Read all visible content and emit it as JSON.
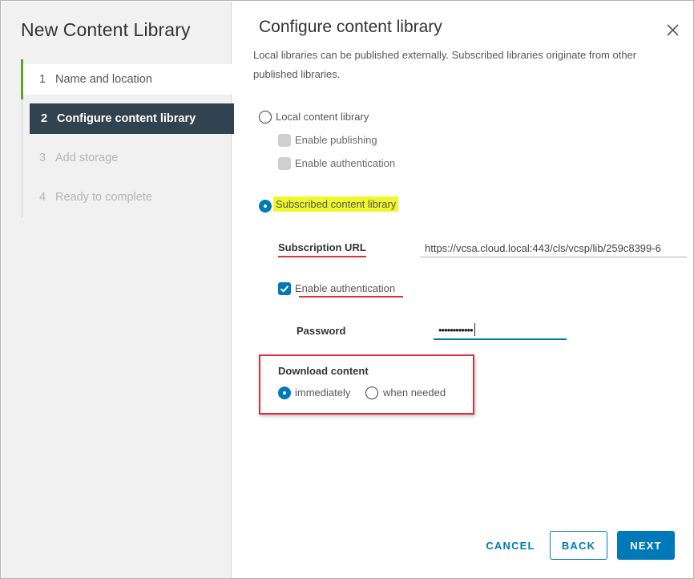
{
  "wizard": {
    "title": "New Content Library",
    "steps": [
      {
        "num": "1",
        "label": "Name and location"
      },
      {
        "num": "2",
        "label": "Configure content library"
      },
      {
        "num": "3",
        "label": "Add storage"
      },
      {
        "num": "4",
        "label": "Ready to complete"
      }
    ]
  },
  "main": {
    "title": "Configure content library",
    "description": "Local libraries can be published externally. Subscribed libraries originate from other published libraries.",
    "local": {
      "label": "Local content library",
      "enable_publishing": "Enable publishing",
      "enable_authentication": "Enable authentication"
    },
    "subscribed": {
      "label": "Subscribed content library",
      "url_label": "Subscription URL",
      "url_value": "https://vcsa.cloud.local:443/cls/vcsp/lib/259c8399-6",
      "enable_authentication": "Enable authentication",
      "password_label": "Password",
      "password_value": "••••••••••••"
    },
    "download": {
      "label": "Download content",
      "immediately": "immediately",
      "when_needed": "when needed"
    }
  },
  "footer": {
    "cancel": "CANCEL",
    "back": "BACK",
    "next": "NEXT"
  },
  "colors": {
    "accent": "#0079b8",
    "active_step_bg": "#314351",
    "completed_step_bar": "#62a420",
    "highlight": "#f0f72c",
    "annotation_red": "#d9343c"
  }
}
